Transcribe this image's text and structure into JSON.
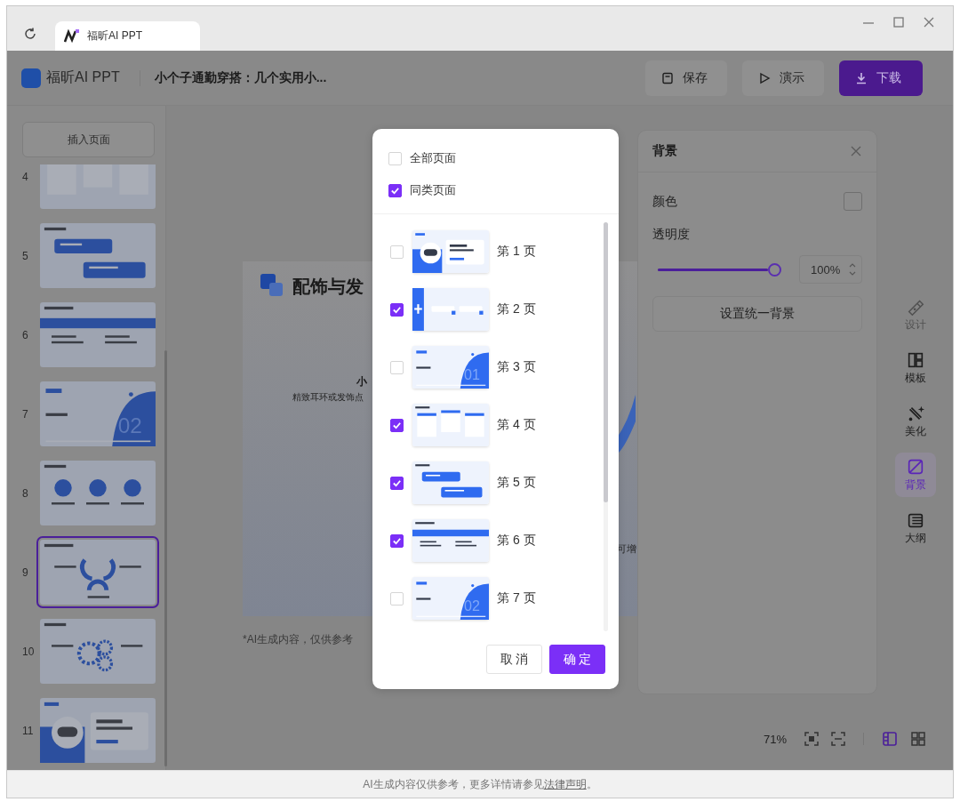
{
  "window": {
    "tab_title": "福昕AI PPT"
  },
  "header": {
    "app_name": "福昕AI PPT",
    "doc_title": "小个子通勤穿搭：几个实用小...",
    "buttons": [
      {
        "label": "保存",
        "kind": "save"
      },
      {
        "label": "演示",
        "kind": "play"
      },
      {
        "label": "下载",
        "kind": "download"
      }
    ]
  },
  "sidebar": {
    "insert_button": "插入页面",
    "slides": [
      {
        "number": "4",
        "kind": "cards",
        "selected": false
      },
      {
        "number": "5",
        "kind": "banners",
        "selected": false
      },
      {
        "number": "6",
        "kind": "columns",
        "selected": false
      },
      {
        "number": "7",
        "kind": "section",
        "label": "02",
        "selected": false
      },
      {
        "number": "8",
        "kind": "icons",
        "selected": false
      },
      {
        "number": "9",
        "kind": "hub",
        "selected": true
      },
      {
        "number": "10",
        "kind": "gears",
        "selected": false
      },
      {
        "number": "11",
        "kind": "robot",
        "selected": false
      }
    ]
  },
  "canvas": {
    "title": "配饰与发",
    "subtitle": "小",
    "caption": "精致耳环或发饰点",
    "side_text": "可增",
    "note": "*AI生成内容，仅供参考"
  },
  "background_panel": {
    "title": "背景",
    "color_label": "颜色",
    "opacity_label": "透明度",
    "opacity": {
      "level": 1,
      "value": "100%"
    },
    "apply_button": "设置统一背景"
  },
  "rail": [
    {
      "label": "设计",
      "selected": false,
      "disabled": true
    },
    {
      "label": "模板",
      "selected": false,
      "disabled": false
    },
    {
      "label": "美化",
      "selected": false,
      "disabled": false
    },
    {
      "label": "背景",
      "selected": true,
      "disabled": false
    },
    {
      "label": "大纲",
      "selected": false,
      "disabled": false
    }
  ],
  "zoom": {
    "value": "71%",
    "views": [
      {
        "selected": true
      },
      {
        "selected": false
      }
    ]
  },
  "modal": {
    "scope": [
      {
        "label": "全部页面",
        "checked": false
      },
      {
        "label": "同类页面",
        "checked": true
      }
    ],
    "pages": [
      {
        "label": "第 1 页",
        "kind": "robot",
        "checked": false
      },
      {
        "label": "第 2 页",
        "kind": "sidebar",
        "checked": true
      },
      {
        "label": "第 3 页",
        "kind": "section",
        "thumb_label": "01",
        "checked": false
      },
      {
        "label": "第 4 页",
        "kind": "cards",
        "checked": true
      },
      {
        "label": "第 5 页",
        "kind": "banners",
        "checked": true
      },
      {
        "label": "第 6 页",
        "kind": "columns",
        "checked": true
      },
      {
        "label": "第 7 页",
        "kind": "section",
        "thumb_label": "02",
        "checked": false
      }
    ],
    "buttons": [
      {
        "label": "取 消",
        "kind": "secondary"
      },
      {
        "label": "确 定",
        "kind": "primary"
      }
    ]
  },
  "status_bar": {
    "text": "AI生成内容仅供参考，更多详情请参见",
    "link": "法律声明",
    "suffix": "。"
  }
}
